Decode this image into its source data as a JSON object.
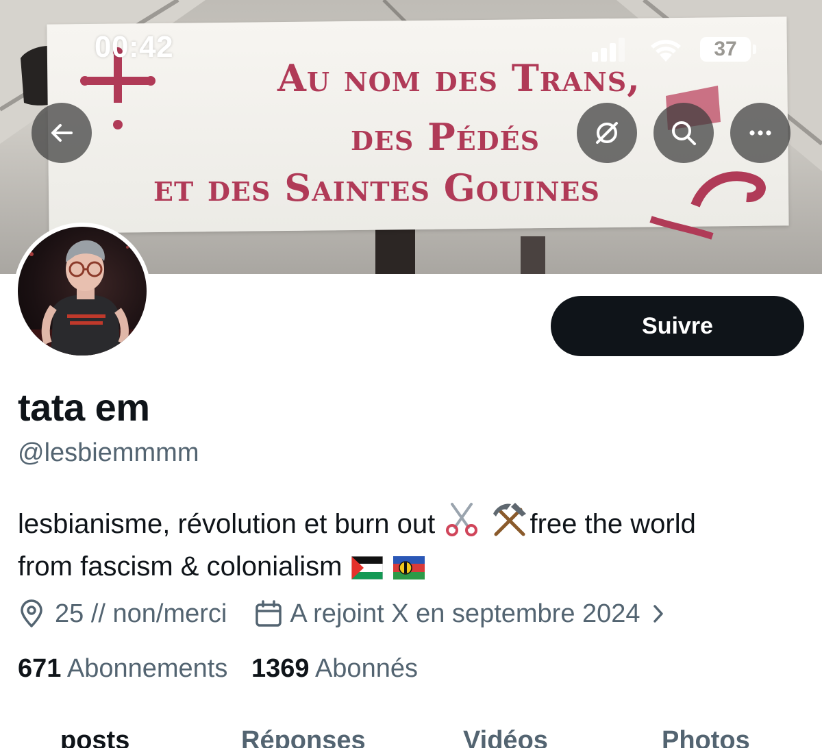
{
  "status_bar": {
    "time": "00:42",
    "battery": "37"
  },
  "banner": {
    "line1": "Au nom des Trans,",
    "line2": "des Pédés",
    "line3": "et des Saintes Gouines"
  },
  "header_actions": {
    "back_icon": "arrow-left-icon",
    "grok_icon": "grok-icon",
    "search_icon": "search-icon",
    "more_icon": "more-icon"
  },
  "profile": {
    "follow_label": "Suivre",
    "display_name": "tata em",
    "handle": "@lesbiemmmm",
    "bio_line1_text": "lesbianisme, révolution et burn out",
    "bio_line1_end": "free the world",
    "bio_line2_text": "from fascism & colonialism",
    "location": "25 // non/merci",
    "joined": "A rejoint X en septembre 2024",
    "following_count": "671",
    "following_label": "Abonnements",
    "followers_count": "1369",
    "followers_label": "Abonnés"
  },
  "tabs": [
    {
      "label": "posts"
    },
    {
      "label": "Réponses"
    },
    {
      "label": "Vidéos"
    },
    {
      "label": "Photos"
    }
  ],
  "colors": {
    "text_primary": "#0f1419",
    "text_secondary": "#536471",
    "button_bg": "#0f1419",
    "banner_text": "#b03a57"
  }
}
